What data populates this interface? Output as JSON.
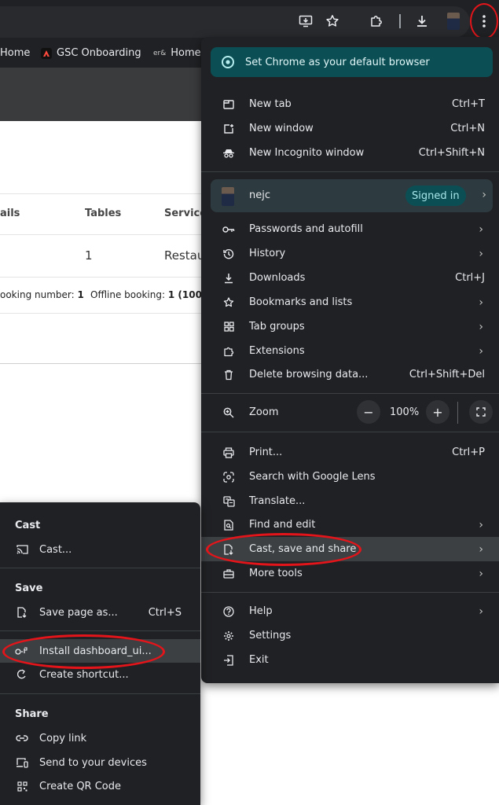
{
  "bookmarks": [
    {
      "label": "Home",
      "icon": "home-bookmark-icon"
    },
    {
      "label": "GSC Onboarding",
      "icon": "adobe-icon"
    },
    {
      "label": "Home",
      "icon": "er-logo-icon",
      "icon_text": "er&"
    }
  ],
  "page": {
    "col_details": "ails",
    "col_tables": "Tables",
    "col_service": "Service",
    "row_tables": "1",
    "row_service": "Restau",
    "summary_online_label": "ooking number:",
    "summary_online_value": "1",
    "summary_offline_label": "Offline booking:",
    "summary_offline_value": "1 (100%"
  },
  "menu": {
    "promo": "Set Chrome as your default browser",
    "new_tab": {
      "label": "New tab",
      "shortcut": "Ctrl+T"
    },
    "new_window": {
      "label": "New window",
      "shortcut": "Ctrl+N"
    },
    "incognito": {
      "label": "New Incognito window",
      "shortcut": "Ctrl+Shift+N"
    },
    "profile": {
      "name": "nejc",
      "status": "Signed in"
    },
    "passwords": "Passwords and autofill",
    "history": "History",
    "downloads": {
      "label": "Downloads",
      "shortcut": "Ctrl+J"
    },
    "bookmarks": "Bookmarks and lists",
    "tab_groups": "Tab groups",
    "extensions": "Extensions",
    "delete_data": {
      "label": "Delete browsing data...",
      "shortcut": "Ctrl+Shift+Del"
    },
    "zoom": {
      "label": "Zoom",
      "value": "100%",
      "minus": "−",
      "plus": "+"
    },
    "print": {
      "label": "Print...",
      "shortcut": "Ctrl+P"
    },
    "lens": "Search with Google Lens",
    "translate": "Translate...",
    "find_edit": "Find and edit",
    "cast_save_share": "Cast, save and share",
    "more_tools": "More tools",
    "help": "Help",
    "settings": "Settings",
    "exit": "Exit"
  },
  "submenu": {
    "cast_heading": "Cast",
    "cast": "Cast...",
    "save_heading": "Save",
    "save_page": {
      "label": "Save page as...",
      "shortcut": "Ctrl+S"
    },
    "install": "Install dashboard_ui...",
    "create_shortcut": "Create shortcut...",
    "share_heading": "Share",
    "copy_link": "Copy link",
    "send_devices": "Send to your devices",
    "qr_code": "Create QR Code"
  },
  "colors": {
    "menu_bg": "#202124",
    "promo_bg": "#0b4f55",
    "highlight": "#3c4043",
    "annotation_red": "#e3151a"
  }
}
